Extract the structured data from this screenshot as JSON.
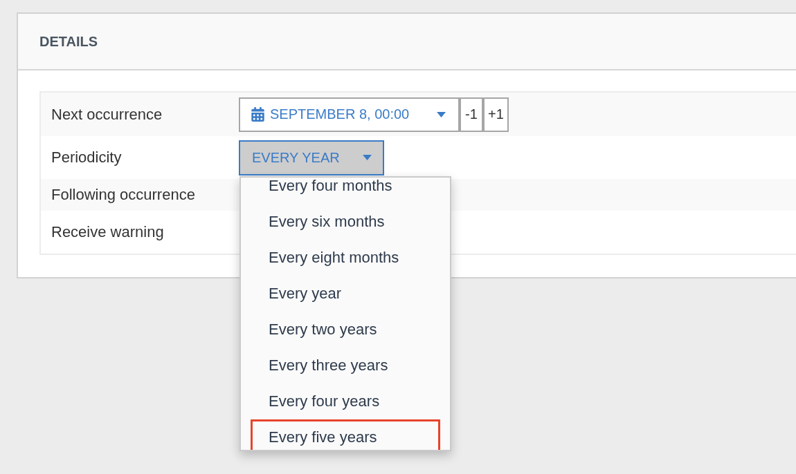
{
  "panel": {
    "title": "DETAILS"
  },
  "rows": [
    {
      "label": "Next occurrence",
      "kind": "date",
      "value": "SEPTEMBER 8, 00:00",
      "buttons": [
        "-1",
        "+1"
      ]
    },
    {
      "label": "Periodicity",
      "kind": "select",
      "value": "EVERY YEAR",
      "open": true,
      "options": [
        {
          "label": "Every four months",
          "highlighted": false
        },
        {
          "label": "Every six months",
          "highlighted": false
        },
        {
          "label": "Every eight months",
          "highlighted": false
        },
        {
          "label": "Every year",
          "highlighted": false
        },
        {
          "label": "Every two years",
          "highlighted": false
        },
        {
          "label": "Every three years",
          "highlighted": false
        },
        {
          "label": "Every four years",
          "highlighted": false
        },
        {
          "label": "Every five years",
          "highlighted": true
        }
      ]
    },
    {
      "label": "Following occurrence",
      "kind": "label"
    },
    {
      "label": "Receive warning",
      "kind": "label"
    }
  ]
}
